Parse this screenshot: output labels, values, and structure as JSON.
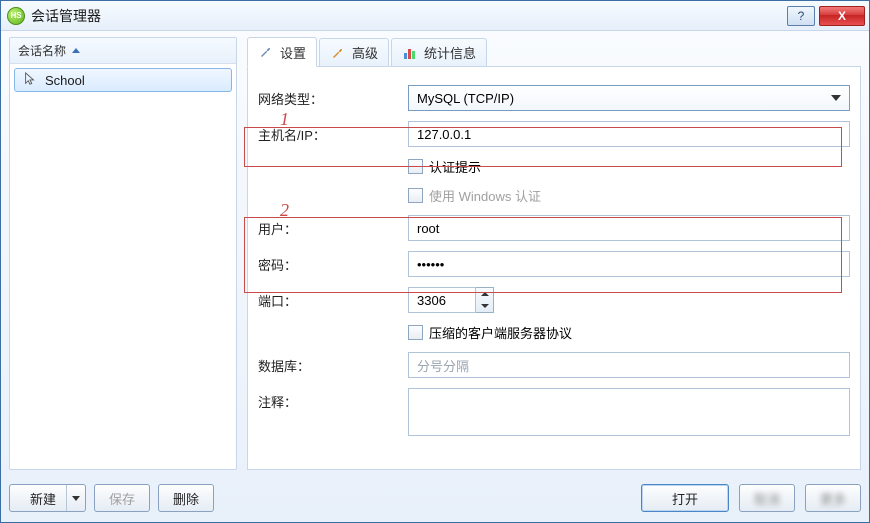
{
  "title": "会话管理器",
  "sidebar": {
    "header": "会话名称",
    "items": [
      {
        "label": "School"
      }
    ]
  },
  "tabs": [
    {
      "label": "设置",
      "icon": "wrench"
    },
    {
      "label": "高级",
      "icon": "wrench-orange"
    },
    {
      "label": "统计信息",
      "icon": "chart"
    }
  ],
  "form": {
    "net_type_label": "网络类型：",
    "net_type_value": "MySQL (TCP/IP)",
    "host_label": "主机名/IP：",
    "host_value": "127.0.0.1",
    "auth_prompt_label": "认证提示",
    "winauth_label": "使用 Windows 认证",
    "user_label": "用户：",
    "user_value": "root",
    "pass_label": "密码：",
    "pass_value": "••••••",
    "port_label": "端口：",
    "port_value": "3306",
    "compress_label": "压缩的客户端服务器协议",
    "db_label": "数据库：",
    "db_placeholder": "分号分隔",
    "comment_label": "注释：",
    "comment_value": ""
  },
  "annotations": {
    "a1": "1",
    "a2": "2"
  },
  "buttons": {
    "new": "新建",
    "save": "保存",
    "delete": "删除",
    "open": "打开",
    "b1": "取消",
    "b2": "更多"
  },
  "winhelp": "?",
  "winclose": "X"
}
